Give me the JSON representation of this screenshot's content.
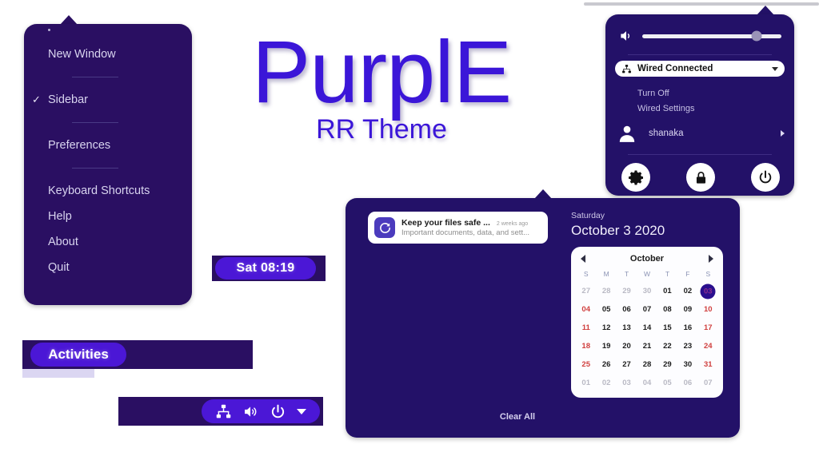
{
  "brand": {
    "title": "PurplE",
    "subtitle": "RR Theme",
    "accent": "#3b16d8"
  },
  "app_menu": {
    "items": [
      {
        "label": "New Window",
        "checked": false
      },
      {
        "label": "Sidebar",
        "checked": true
      },
      {
        "label": "Preferences",
        "checked": false
      },
      {
        "label": "Keyboard Shortcuts",
        "checked": false
      },
      {
        "label": "Help",
        "checked": false
      },
      {
        "label": "About",
        "checked": false
      },
      {
        "label": "Quit",
        "checked": false
      }
    ],
    "check_glyph": "✓"
  },
  "system_menu": {
    "volume": {
      "icon": "volume-icon",
      "level_percent": 82
    },
    "network": {
      "icon": "wired-network-icon",
      "label": "Wired Connected",
      "expanded": true,
      "actions": [
        "Turn Off",
        "Wired Settings"
      ]
    },
    "user": {
      "name": "shanaka",
      "avatar": "user-avatar-icon"
    },
    "actions": [
      {
        "name": "settings",
        "icon": "gear-icon"
      },
      {
        "name": "lock",
        "icon": "lock-icon"
      },
      {
        "name": "power",
        "icon": "power-icon"
      }
    ]
  },
  "clock": {
    "text": "Sat 08:19"
  },
  "activities": {
    "label": "Activities"
  },
  "tray": {
    "icons": [
      "network-icon",
      "volume-icon",
      "power-icon",
      "chevron-down-icon"
    ]
  },
  "notifications": {
    "items": [
      {
        "title": "Keep your files safe ...",
        "time": "2 weeks ago",
        "body": "Important documents, data, and sett...",
        "icon": "sync-refresh-icon"
      }
    ],
    "clear_all_label": "Clear All"
  },
  "calendar": {
    "weekday": "Saturday",
    "full_date": "October  3 2020",
    "month_label": "October",
    "prev_icon": "chevron-left-icon",
    "next_icon": "chevron-right-icon",
    "day_headers": [
      "S",
      "M",
      "T",
      "W",
      "T",
      "F",
      "S"
    ],
    "today": "03",
    "colors": {
      "weekend": "#d0403f",
      "today_bg": "#2a0f8e"
    },
    "weeks": [
      [
        {
          "d": "27",
          "state": "other"
        },
        {
          "d": "28",
          "state": "other"
        },
        {
          "d": "29",
          "state": "other"
        },
        {
          "d": "30",
          "state": "other"
        },
        {
          "d": "01",
          "state": "normal"
        },
        {
          "d": "02",
          "state": "normal"
        },
        {
          "d": "03",
          "state": "today"
        }
      ],
      [
        {
          "d": "04",
          "state": "weekend"
        },
        {
          "d": "05",
          "state": "normal"
        },
        {
          "d": "06",
          "state": "normal"
        },
        {
          "d": "07",
          "state": "normal"
        },
        {
          "d": "08",
          "state": "normal"
        },
        {
          "d": "09",
          "state": "normal"
        },
        {
          "d": "10",
          "state": "weekend"
        }
      ],
      [
        {
          "d": "11",
          "state": "weekend"
        },
        {
          "d": "12",
          "state": "normal"
        },
        {
          "d": "13",
          "state": "normal"
        },
        {
          "d": "14",
          "state": "normal"
        },
        {
          "d": "15",
          "state": "normal"
        },
        {
          "d": "16",
          "state": "normal"
        },
        {
          "d": "17",
          "state": "weekend"
        }
      ],
      [
        {
          "d": "18",
          "state": "weekend"
        },
        {
          "d": "19",
          "state": "normal"
        },
        {
          "d": "20",
          "state": "normal"
        },
        {
          "d": "21",
          "state": "normal"
        },
        {
          "d": "22",
          "state": "normal"
        },
        {
          "d": "23",
          "state": "normal"
        },
        {
          "d": "24",
          "state": "weekend"
        }
      ],
      [
        {
          "d": "25",
          "state": "weekend"
        },
        {
          "d": "26",
          "state": "normal"
        },
        {
          "d": "27",
          "state": "normal"
        },
        {
          "d": "28",
          "state": "normal"
        },
        {
          "d": "29",
          "state": "normal"
        },
        {
          "d": "30",
          "state": "normal"
        },
        {
          "d": "31",
          "state": "weekend"
        }
      ],
      [
        {
          "d": "01",
          "state": "other"
        },
        {
          "d": "02",
          "state": "other"
        },
        {
          "d": "03",
          "state": "other"
        },
        {
          "d": "04",
          "state": "other"
        },
        {
          "d": "05",
          "state": "other"
        },
        {
          "d": "06",
          "state": "other"
        },
        {
          "d": "07",
          "state": "other"
        }
      ]
    ]
  }
}
